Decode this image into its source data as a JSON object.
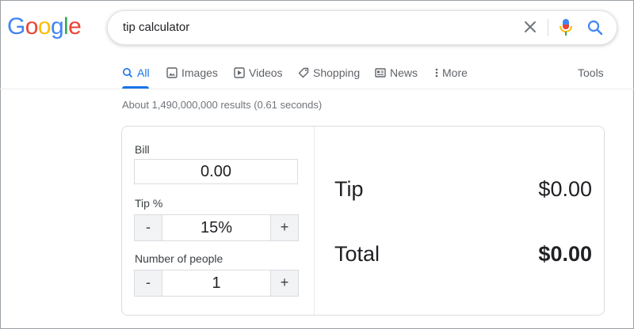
{
  "logo": "Google",
  "colors": {
    "google_blue": "#4285F4",
    "google_red": "#EA4335",
    "google_yellow": "#FBBC05",
    "google_green": "#34A853",
    "accent": "#1a73e8"
  },
  "search": {
    "query": "tip calculator",
    "clear_icon": "close-icon",
    "voice_icon": "microphone-icon",
    "search_icon": "search-icon"
  },
  "tabs": [
    {
      "label": "All",
      "icon": "search-icon",
      "active": true
    },
    {
      "label": "Images",
      "icon": "image-icon"
    },
    {
      "label": "Videos",
      "icon": "play-icon"
    },
    {
      "label": "Shopping",
      "icon": "tag-icon"
    },
    {
      "label": "News",
      "icon": "newspaper-icon"
    },
    {
      "label": "More",
      "icon": "vertical-dots-icon"
    }
  ],
  "tools_label": "Tools",
  "results_stats": "About 1,490,000,000 results (0.61 seconds)",
  "calculator": {
    "bill_label": "Bill",
    "bill_value": "0.00",
    "tip_label": "Tip %",
    "tip_value": "15%",
    "people_label": "Number of people",
    "people_value": "1",
    "minus": "-",
    "plus": "+",
    "tip_result_label": "Tip",
    "tip_result_value": "$0.00",
    "total_result_label": "Total",
    "total_result_value": "$0.00"
  }
}
